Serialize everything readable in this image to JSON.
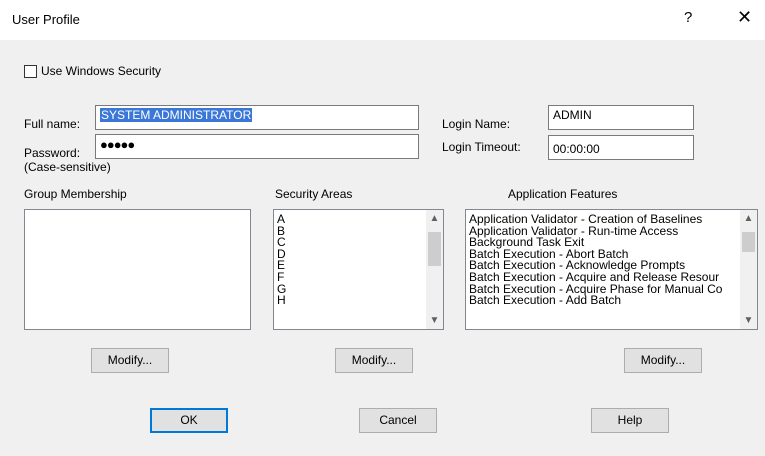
{
  "window": {
    "title": "User Profile",
    "help_glyph": "?",
    "close_glyph": "✕"
  },
  "use_windows_security": {
    "label": "Use Windows Security",
    "checked": false
  },
  "full_name": {
    "label": "Full name:",
    "value": "SYSTEM ADMINISTRATOR"
  },
  "password": {
    "label": "Password:",
    "note": "(Case-sensitive)",
    "value": "●●●●●"
  },
  "login_name": {
    "label": "Login Name:",
    "value": "ADMIN"
  },
  "login_timeout": {
    "label": "Login Timeout:",
    "value": "00:00:00"
  },
  "group_membership": {
    "label": "Group Membership",
    "items": [],
    "modify_label": "Modify..."
  },
  "security_areas": {
    "label": "Security Areas",
    "items": [
      "A",
      "B",
      "C",
      "D",
      "E",
      "F",
      "G",
      "H"
    ],
    "modify_label": "Modify..."
  },
  "application_features": {
    "label": "Application Features",
    "items": [
      "Application Validator - Creation of Baselines",
      "Application Validator - Run-time Access",
      "Background Task Exit",
      "Batch Execution - Abort Batch",
      "Batch Execution - Acknowledge Prompts",
      "Batch Execution - Acquire and Release Resour",
      "Batch Execution - Acquire Phase for Manual Co",
      "Batch Execution - Add Batch"
    ],
    "modify_label": "Modify..."
  },
  "buttons": {
    "ok": "OK",
    "cancel": "Cancel",
    "help": "Help"
  },
  "icons": {
    "scroll_up": "up-arrow-icon",
    "scroll_down": "down-arrow-icon"
  },
  "colors": {
    "selection": "#3b77d6",
    "default_button_border": "#0078d7"
  }
}
